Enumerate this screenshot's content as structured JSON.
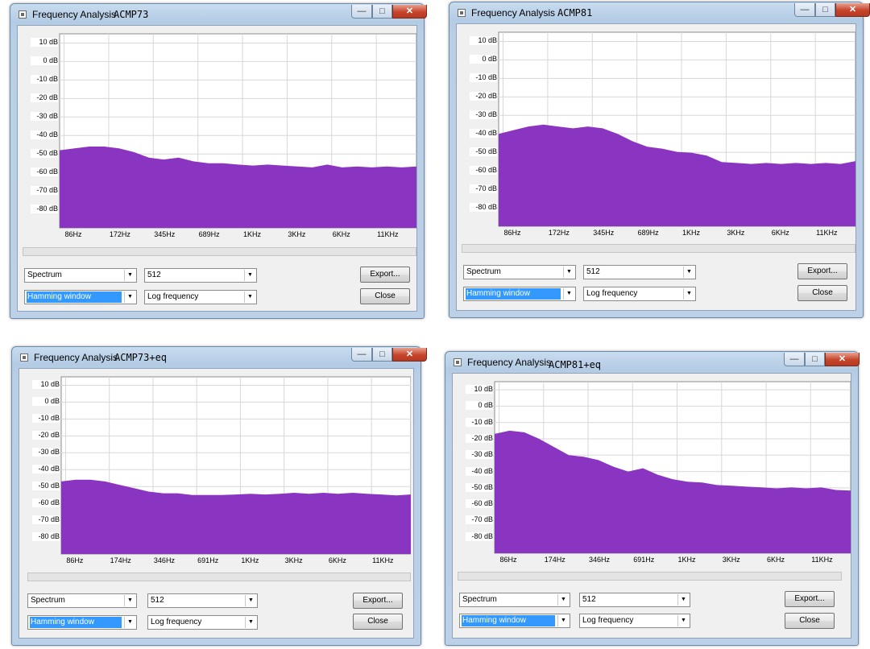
{
  "windows": [
    {
      "title": "Frequency Analysis",
      "file": "ACMP73",
      "title_buttons": {
        "minimize": "—",
        "maximize": "□",
        "close": "✕"
      },
      "y_ticks": [
        "10 dB",
        "0 dB",
        "-10 dB",
        "-20 dB",
        "-30 dB",
        "-40 dB",
        "-50 dB",
        "-60 dB",
        "-70 dB",
        "-80 dB"
      ],
      "x_ticks": [
        "86Hz",
        "172Hz",
        "345Hz",
        "689Hz",
        "1KHz",
        "3KHz",
        "6KHz",
        "11KHz"
      ],
      "algorithm": "Spectrum",
      "size": "512",
      "window_func": "Hamming window",
      "axis": "Log frequency",
      "export_label": "Export...",
      "close_label": "Close",
      "spectrum_db": [
        -48,
        -47,
        -46,
        -46,
        -47,
        -49,
        -52,
        -53,
        -52,
        -54,
        -55,
        -55,
        -56,
        -56,
        -56,
        -56,
        -57,
        -57,
        -56,
        -57,
        -57,
        -57,
        -57,
        -57,
        -57
      ],
      "fill_color": "#8a35c2"
    },
    {
      "title": "Frequency Analysis",
      "file": "ACMP81",
      "title_buttons": {
        "minimize": "—",
        "maximize": "□",
        "close": "✕"
      },
      "y_ticks": [
        "10 dB",
        "0 dB",
        "-10 dB",
        "-20 dB",
        "-30 dB",
        "-40 dB",
        "-50 dB",
        "-60 dB",
        "-70 dB",
        "-80 dB"
      ],
      "x_ticks": [
        "86Hz",
        "172Hz",
        "345Hz",
        "689Hz",
        "1KHz",
        "3KHz",
        "6KHz",
        "11KHz"
      ],
      "algorithm": "Spectrum",
      "size": "512",
      "window_func": "Hamming window",
      "axis": "Log frequency",
      "export_label": "Export...",
      "close_label": "Close",
      "spectrum_db": [
        -40,
        -38,
        -36,
        -35,
        -36,
        -37,
        -36,
        -37,
        -40,
        -44,
        -47,
        -48,
        -50,
        -50,
        -52,
        -55,
        -56,
        -56,
        -56,
        -56,
        -56,
        -56,
        -56,
        -56,
        -55
      ],
      "fill_color": "#8a35c2"
    },
    {
      "title": "Frequency Analysis",
      "file": "ACMP73+eq",
      "title_buttons": {
        "minimize": "—",
        "maximize": "□",
        "close": "✕"
      },
      "y_ticks": [
        "10 dB",
        "0 dB",
        "-10 dB",
        "-20 dB",
        "-30 dB",
        "-40 dB",
        "-50 dB",
        "-60 dB",
        "-70 dB",
        "-80 dB"
      ],
      "x_ticks": [
        "86Hz",
        "174Hz",
        "346Hz",
        "691Hz",
        "1KHz",
        "3KHz",
        "6KHz",
        "11KHz"
      ],
      "algorithm": "Spectrum",
      "size": "512",
      "window_func": "Hamming window",
      "axis": "Log frequency",
      "export_label": "Export...",
      "close_label": "Close",
      "spectrum_db": [
        -47,
        -46,
        -46,
        -47,
        -49,
        -51,
        -53,
        -54,
        -54,
        -55,
        -55,
        -55,
        -55,
        -54,
        -55,
        -54,
        -54,
        -54,
        -54,
        -54,
        -54,
        -54,
        -55,
        -55,
        -55
      ],
      "fill_color": "#8a35c2"
    },
    {
      "title": "Frequency Analysis",
      "file": "ACMP81+eq",
      "title_buttons": {
        "minimize": "—",
        "maximize": "□",
        "close": "✕"
      },
      "y_ticks": [
        "10 dB",
        "0 dB",
        "-10 dB",
        "-20 dB",
        "-30 dB",
        "-40 dB",
        "-50 dB",
        "-60 dB",
        "-70 dB",
        "-80 dB"
      ],
      "x_ticks": [
        "86Hz",
        "174Hz",
        "346Hz",
        "691Hz",
        "1KHz",
        "3KHz",
        "6KHz",
        "11KHz"
      ],
      "algorithm": "Spectrum",
      "size": "512",
      "window_func": "Hamming window",
      "axis": "Log frequency",
      "export_label": "Export...",
      "close_label": "Close",
      "spectrum_db": [
        -17,
        -15,
        -16,
        -20,
        -25,
        -30,
        -31,
        -33,
        -37,
        -40,
        -38,
        -42,
        -45,
        -46,
        -47,
        -48,
        -49,
        -49,
        -50,
        -50,
        -50,
        -50,
        -50,
        -51,
        -52
      ],
      "fill_color": "#8a35c2"
    }
  ]
}
